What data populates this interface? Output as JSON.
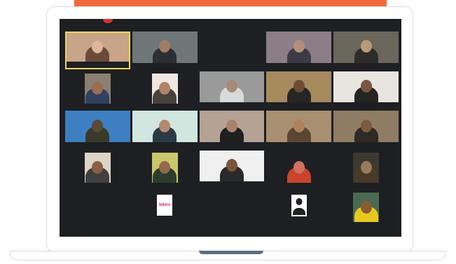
{
  "participants": [
    {
      "name": "",
      "kind": "video",
      "bg": "#c8a488",
      "skin": "#e0b59a",
      "shirt": "#6b4a3a",
      "active": true
    },
    {
      "name": "",
      "kind": "video",
      "bg": "#6f7678",
      "skin": "#a07c62",
      "shirt": "#2b2f33"
    },
    {
      "name": "",
      "kind": "name",
      "label": ""
    },
    {
      "name": "",
      "kind": "video",
      "bg": "#8c7e86",
      "skin": "#b48f7c",
      "shirt": "#3c3a45"
    },
    {
      "name": "",
      "kind": "video",
      "bg": "#6a665c",
      "skin": "#b89a78",
      "shirt": "#2e2c28"
    },
    {
      "name": "",
      "kind": "videosmall",
      "bg": "#8a7f70",
      "skin": "#9a6e4e",
      "shirt": "#2f4060"
    },
    {
      "name": "",
      "kind": "videosmall",
      "bg": "#efe8e2",
      "skin": "#b38366",
      "shirt": "#49413d"
    },
    {
      "name": "",
      "kind": "video",
      "bg": "#9a9a9a",
      "skin": "#a88a78",
      "shirt": "#d9d9d9"
    },
    {
      "name": "",
      "kind": "video",
      "bg": "#a68a5e",
      "skin": "#6e4c34",
      "shirt": "#262626"
    },
    {
      "name": "",
      "kind": "video",
      "bg": "#e8e4e0",
      "skin": "#7a5640",
      "shirt": "#252525"
    },
    {
      "name": "",
      "kind": "video",
      "bg": "#3d7fc0",
      "skin": "#5a4a38",
      "shirt": "#3a3a2a"
    },
    {
      "name": "",
      "kind": "video",
      "bg": "#d2e6e0",
      "skin": "#b48a6e",
      "shirt": "#2a3a44"
    },
    {
      "name": "",
      "kind": "video",
      "bg": "#b4a294",
      "skin": "#a8826a",
      "shirt": "#1f1f1f"
    },
    {
      "name": "",
      "kind": "video",
      "bg": "#a89070",
      "skin": "#b08060",
      "shirt": "#5a4632"
    },
    {
      "name": "",
      "kind": "video",
      "bg": "#8f7c64",
      "skin": "#7c5a42",
      "shirt": "#2f2a26"
    },
    {
      "name": "",
      "kind": "videosmall",
      "bg": "#ddd3c7",
      "skin": "#8a5e44",
      "shirt": "#3f3f3f"
    },
    {
      "name": "",
      "kind": "videosmall",
      "bg": "#c8c86a",
      "skin": "#94684c",
      "shirt": "#2e3c2c"
    },
    {
      "name": "",
      "kind": "video",
      "bg": "#f0f0f0",
      "skin": "#7a553c",
      "shirt": "#2a2a2a"
    },
    {
      "name": "",
      "kind": "videosmall",
      "bg": "#1d1f22",
      "skin": "#d07060",
      "shirt": "#c8442e"
    },
    {
      "name": "",
      "kind": "videosmall",
      "bg": "#3c3a30",
      "skin": "#9a7a5a",
      "shirt": "#4a3a2a"
    },
    {
      "name": "",
      "kind": "name",
      "label": ""
    },
    {
      "name": "",
      "kind": "logo",
      "logo_text": "bdere"
    },
    {
      "name": "",
      "kind": "name",
      "label": ""
    },
    {
      "name": "",
      "kind": "silhouette"
    },
    {
      "name": "",
      "kind": "videosmall",
      "bg": "#4a6a52",
      "skin": "#8a5a34",
      "shirt": "#e8c81e"
    }
  ],
  "colors": {
    "banner": "#ef6a3a",
    "screen": "#1d1f22",
    "active_border": "#e9d85a",
    "laptop_outline": "#d7dde2",
    "hinge": "#5b6f7f"
  }
}
